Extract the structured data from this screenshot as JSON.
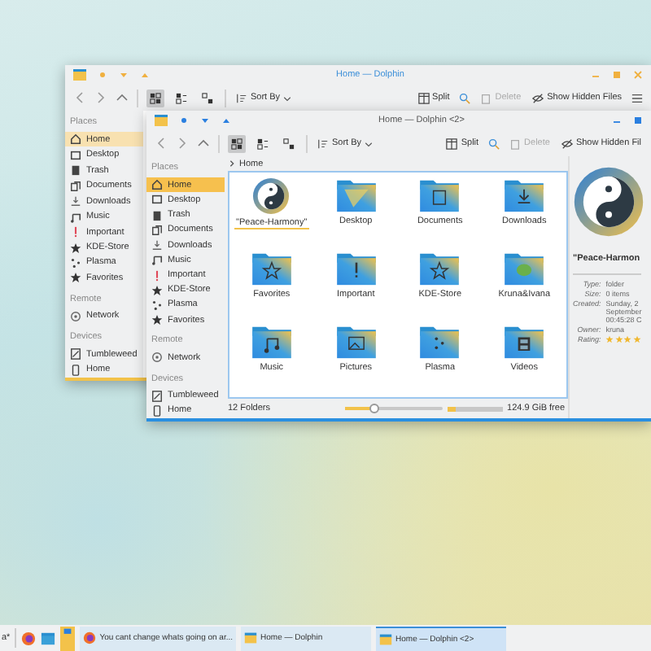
{
  "back_window": {
    "title": "Home — Dolphin",
    "active": false,
    "toolbar": {
      "views": [
        {
          "kind": "icons",
          "selected": true
        },
        {
          "kind": "compact",
          "selected": false
        },
        {
          "kind": "details",
          "selected": false
        }
      ],
      "sort_by": "Sort By",
      "split": "Split",
      "delete": {
        "label": "Delete",
        "disabled": true
      },
      "hidden_files": "Show Hidden Files"
    },
    "sidebar": [
      {
        "heading": "Places",
        "items": [
          {
            "label": "Home",
            "kind": "home",
            "selected": true
          },
          {
            "label": "Desktop",
            "kind": "desktop",
            "selected": false
          },
          {
            "label": "Trash",
            "kind": "trash",
            "selected": false
          },
          {
            "label": "Documents",
            "kind": "documents",
            "selected": false
          },
          {
            "label": "Downloads",
            "kind": "downloads",
            "selected": false
          },
          {
            "label": "Music",
            "kind": "music",
            "selected": false
          },
          {
            "label": "Important",
            "kind": "important",
            "selected": false
          },
          {
            "label": "KDE-Store",
            "kind": "star",
            "selected": false
          },
          {
            "label": "Plasma",
            "kind": "plasma",
            "selected": false
          },
          {
            "label": "Favorites",
            "kind": "star",
            "selected": false
          }
        ]
      },
      {
        "heading": "Remote",
        "items": [
          {
            "label": "Network",
            "kind": "network",
            "selected": false
          }
        ]
      },
      {
        "heading": "Devices",
        "items": [
          {
            "label": "Tumbleweed",
            "kind": "drive",
            "selected": false
          },
          {
            "label": "Home",
            "kind": "phone",
            "selected": false
          }
        ]
      }
    ]
  },
  "front_window": {
    "title": "Home — Dolphin <2>",
    "active": true,
    "toolbar": {
      "views": [
        {
          "kind": "icons",
          "selected": true
        },
        {
          "kind": "compact",
          "selected": false
        },
        {
          "kind": "details",
          "selected": false
        }
      ],
      "sort_by": "Sort By",
      "split": "Split",
      "delete": {
        "label": "Delete",
        "disabled": true
      },
      "hidden_files": "Show Hidden Fil"
    },
    "sidebar": [
      {
        "heading": "Places",
        "items": [
          {
            "label": "Home",
            "kind": "home",
            "selected": true
          },
          {
            "label": "Desktop",
            "kind": "desktop",
            "selected": false
          },
          {
            "label": "Trash",
            "kind": "trash",
            "selected": false
          },
          {
            "label": "Documents",
            "kind": "documents",
            "selected": false
          },
          {
            "label": "Downloads",
            "kind": "downloads",
            "selected": false
          },
          {
            "label": "Music",
            "kind": "music",
            "selected": false
          },
          {
            "label": "Important",
            "kind": "important",
            "selected": false
          },
          {
            "label": "KDE-Store",
            "kind": "star",
            "selected": false
          },
          {
            "label": "Plasma",
            "kind": "plasma",
            "selected": false
          },
          {
            "label": "Favorites",
            "kind": "star",
            "selected": false
          }
        ]
      },
      {
        "heading": "Remote",
        "items": [
          {
            "label": "Network",
            "kind": "network",
            "selected": false
          }
        ]
      },
      {
        "heading": "Devices",
        "items": [
          {
            "label": "Tumbleweed",
            "kind": "drive",
            "selected": false
          },
          {
            "label": "Home",
            "kind": "phone",
            "selected": false
          }
        ]
      }
    ],
    "breadcrumb": "Home",
    "items": [
      {
        "label": "\"Peace-Harmony\"",
        "kind": "yinyang",
        "selected": true
      },
      {
        "label": "Desktop",
        "kind": "desktop",
        "selected": false
      },
      {
        "label": "Documents",
        "kind": "documents",
        "selected": false
      },
      {
        "label": "Downloads",
        "kind": "downloads",
        "selected": false
      },
      {
        "label": "Favorites",
        "kind": "star",
        "selected": false
      },
      {
        "label": "Important",
        "kind": "important",
        "selected": false
      },
      {
        "label": "KDE-Store",
        "kind": "store",
        "selected": false
      },
      {
        "label": "Kruna&Ivana",
        "kind": "people",
        "selected": false
      },
      {
        "label": "Music",
        "kind": "music",
        "selected": false
      },
      {
        "label": "Pictures",
        "kind": "pictures",
        "selected": false
      },
      {
        "label": "Plasma",
        "kind": "plasma",
        "selected": false
      },
      {
        "label": "Videos",
        "kind": "videos",
        "selected": false
      }
    ],
    "status": {
      "count": "12 Folders",
      "zoom": {
        "level": 0.3
      },
      "storage": {
        "level": 0.15
      },
      "free": "124.9 GiB free"
    },
    "info_panel": {
      "name": "\"Peace-Harmon",
      "rows": [
        {
          "key": "Type:",
          "value": "folder"
        },
        {
          "key": "Size:",
          "value": "0 items"
        },
        {
          "key": "Created:",
          "value": "Sunday, 2\nSeptember\n00:45:28 C"
        },
        {
          "key": "Owner:",
          "value": "kruna"
        },
        {
          "key": "Rating:",
          "stars": 4
        }
      ]
    }
  },
  "taskbar": {
    "cut_text": "a*",
    "tasks": [
      {
        "label": "You cant change whats going on ar...",
        "kind": "browser",
        "selected": false
      },
      {
        "label": "Home — Dolphin",
        "kind": "files",
        "selected": false
      },
      {
        "label": "Home — Dolphin <2>",
        "kind": "files",
        "selected": true
      }
    ]
  }
}
